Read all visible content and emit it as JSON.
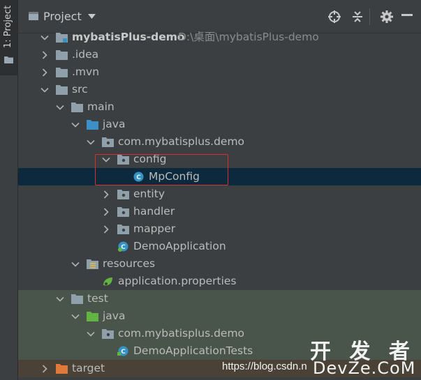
{
  "toolwindow_strip": {
    "tab_label": "1: Project"
  },
  "header": {
    "title": "Project"
  },
  "tree": [
    {
      "label": "mybatisPlus-demo",
      "path": "D:\\桌面\\mybatisPlus-demo",
      "bold": true,
      "expanded": true,
      "icon": "module-folder-icon"
    },
    {
      "label": ".idea",
      "expanded": false,
      "icon": "folder-icon"
    },
    {
      "label": ".mvn",
      "expanded": false,
      "icon": "folder-icon"
    },
    {
      "label": "src",
      "expanded": true,
      "icon": "folder-icon"
    },
    {
      "label": "main",
      "expanded": true,
      "icon": "folder-icon"
    },
    {
      "label": "java",
      "expanded": true,
      "icon": "source-root-icon"
    },
    {
      "label": "com.mybatisplus.demo",
      "expanded": true,
      "icon": "package-icon"
    },
    {
      "label": "config",
      "expanded": true,
      "icon": "package-icon"
    },
    {
      "label": "MpConfig",
      "icon": "class-icon",
      "selected": true
    },
    {
      "label": "entity",
      "expanded": false,
      "icon": "package-icon"
    },
    {
      "label": "handler",
      "expanded": false,
      "icon": "package-icon"
    },
    {
      "label": "mapper",
      "expanded": false,
      "icon": "package-icon"
    },
    {
      "label": "DemoApplication",
      "icon": "spring-boot-class-icon"
    },
    {
      "label": "resources",
      "expanded": true,
      "icon": "resources-root-icon"
    },
    {
      "label": "application.properties",
      "icon": "spring-properties-icon"
    },
    {
      "label": "test",
      "expanded": true,
      "icon": "folder-icon"
    },
    {
      "label": "java",
      "expanded": true,
      "icon": "test-root-icon"
    },
    {
      "label": "com.mybatisplus.demo",
      "expanded": true,
      "icon": "package-icon"
    },
    {
      "label": "DemoApplicationTests",
      "icon": "test-class-icon"
    },
    {
      "label": "target",
      "expanded": false,
      "icon": "excluded-folder-icon"
    }
  ],
  "watermark": {
    "url": "https://blog.csdn.n",
    "brand_cn": "开 发 者",
    "brand_en": "DevZe.CoM"
  },
  "colors": {
    "selected_row": "#0d293e",
    "highlight_box": "#d9302b",
    "test_tint": "#49544a",
    "target_tint": "#4a4236"
  }
}
